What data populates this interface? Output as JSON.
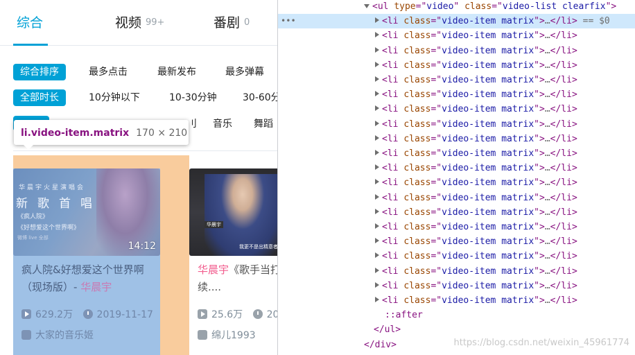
{
  "search_page": {
    "tabs": [
      {
        "label": "综合",
        "count": ""
      },
      {
        "label": "视频",
        "count": "99+"
      },
      {
        "label": "番剧",
        "count": "0"
      }
    ],
    "sort_filters": [
      "综合排序",
      "最多点击",
      "最新发布",
      "最多弹幕"
    ],
    "duration_filters": [
      "全部时长",
      "10分钟以下",
      "10-30分钟",
      "30-60分"
    ],
    "category_filters": [
      "刂",
      "音乐",
      "舞蹈"
    ],
    "tooltip": {
      "selector": "li.video-item.matrix",
      "size": "170 × 210"
    },
    "videos": [
      {
        "thumb_lines": [
          "华晨宇火星演唱会",
          "新歌首唱",
          "《疯人院》",
          "《好想爱这个世界啊》",
          "微博 live 全部"
        ],
        "duration": "14:12",
        "title_prefix": "疯人院&好想爱这个世界啊（现场版）- ",
        "title_highlight": "华晨宇",
        "views": "629.2万",
        "date": "2019-11-17",
        "uploader": "大家的音乐姬"
      },
      {
        "thumb_tag": "华晨宇",
        "thumb_caption": "我更不是出精意者心",
        "title_highlight": "华晨宇",
        "title_rest": "《歌手当打人CUT（待续....",
        "views": "25.6万",
        "date": "20",
        "uploader": "绵儿1993"
      }
    ]
  },
  "devtools": {
    "parent_open": {
      "tag": "ul",
      "attrs": [
        [
          "type",
          "video"
        ],
        [
          "class",
          "video-list clearfix"
        ]
      ]
    },
    "item_class": "video-item matrix",
    "item_tag": "li",
    "item_count": 20,
    "selected_suffix": "== $0",
    "ellipsis": "…",
    "after_pseudo": "::after",
    "closing_ul": "</ul>",
    "closing_div": "</div>",
    "dots": "•••"
  },
  "watermark": "https://blog.csdn.net/weixin_45961774"
}
